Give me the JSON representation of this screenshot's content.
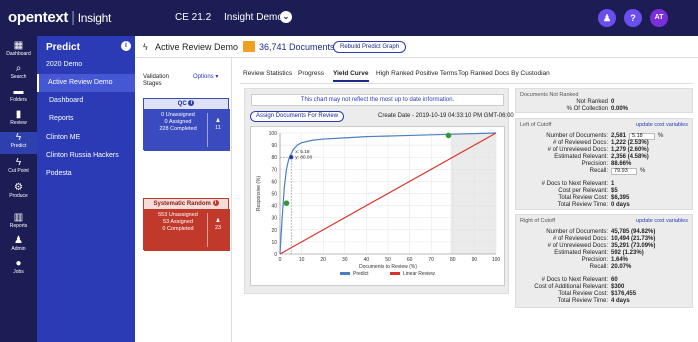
{
  "topbar": {
    "brand": "opentext",
    "product": "Insight",
    "version": "CE 21.2",
    "project": "Insight Demo",
    "help_label": "?",
    "user_initials": "AT"
  },
  "rail": {
    "items": [
      {
        "label": "Dashboard",
        "icon": "dashboard-icon"
      },
      {
        "label": "Search",
        "icon": "search-icon"
      },
      {
        "label": "Folders",
        "icon": "folder-icon"
      },
      {
        "label": "Review",
        "icon": "review-icon"
      },
      {
        "label": "Predict",
        "icon": "bolt-icon"
      },
      {
        "label": "Cut Point",
        "icon": "cut-icon"
      },
      {
        "label": "Produce",
        "icon": "gears-icon"
      },
      {
        "label": "Reports",
        "icon": "chart-icon"
      },
      {
        "label": "Admin",
        "icon": "admin-icon"
      },
      {
        "label": "Jobs",
        "icon": "jobs-icon"
      }
    ]
  },
  "predict_panel": {
    "title": "Predict",
    "items": [
      {
        "label": "2020 Demo"
      },
      {
        "label": "Active Review Demo"
      },
      {
        "label": "Dashboard"
      },
      {
        "label": "Reports"
      },
      {
        "label": "Clinton ME"
      },
      {
        "label": "Clinton Russia Hackers"
      },
      {
        "label": "Podesta"
      }
    ]
  },
  "header": {
    "view_title": "Active Review Demo",
    "doc_count": "36,741 Documents",
    "rebuild_label": "Rebuild Predict Graph"
  },
  "validation": {
    "label": "Validation Stages",
    "options_label": "Options ▾",
    "qc": {
      "title": "QC",
      "badge": "i",
      "lines": [
        "0 Unassigned",
        "0 Assigned",
        "228 Completed"
      ],
      "user_count": "11"
    },
    "sr": {
      "title": "Systematic Random",
      "badge": "i",
      "lines": [
        "553 Unassigned",
        "53 Assigned",
        "0 Completed"
      ],
      "user_count": "23"
    }
  },
  "tabs": [
    {
      "label": "Review Statistics"
    },
    {
      "label": "Progress"
    },
    {
      "label": "Yield Curve"
    },
    {
      "label": "High Ranked Positive Terms"
    },
    {
      "label": "Top Ranked Docs By Custodian"
    }
  ],
  "chart_panel": {
    "notice": "This chart may not reflect the most up to date information.",
    "assign_label": "Assign Documents For Review",
    "create_date": "Create Date - 2019-10-19 04:33:10 PM GMT-06:00"
  },
  "chart_data": {
    "type": "line",
    "xlabel": "Documents to Review (%)",
    "ylabel": "Responsive (%)",
    "xlim": [
      0,
      100
    ],
    "ylim": [
      0,
      100
    ],
    "x_ticks": [
      0,
      10,
      20,
      30,
      40,
      50,
      60,
      70,
      80,
      90,
      100
    ],
    "y_ticks": [
      0,
      10,
      20,
      30,
      40,
      50,
      60,
      70,
      80,
      90,
      100
    ],
    "grid": true,
    "legend_position": "bottom",
    "series": [
      {
        "name": "Predict",
        "color": "#4a7fc1",
        "x": [
          0,
          1,
          2,
          3,
          4,
          5,
          6,
          8,
          10,
          15,
          20,
          30,
          40,
          60,
          80,
          100
        ],
        "y": [
          0,
          30,
          55,
          70,
          78,
          82,
          86,
          90,
          92,
          94,
          95,
          96,
          97,
          98,
          99,
          100
        ]
      },
      {
        "name": "Linear Review",
        "color": "#d9342b",
        "x": [
          0,
          100
        ],
        "y": [
          0,
          100
        ]
      }
    ],
    "annotations": [
      {
        "type": "tooltip",
        "x": 5.18,
        "y": 80.0,
        "text_x": "x: 5.18",
        "text_y": "y: 80.00"
      }
    ],
    "markers": [
      {
        "x": 3,
        "y": 42,
        "color": "#2f9a35"
      },
      {
        "x": 78,
        "y": 98,
        "color": "#2f9a35"
      }
    ],
    "shaded_from_x": 79
  },
  "stats": {
    "not_ranked": {
      "header": "Documents Not Ranked",
      "rows": [
        {
          "k": "Not Ranked",
          "v": "0"
        },
        {
          "k": "% Of Collection",
          "v": "0.00%"
        }
      ]
    },
    "left": {
      "header": "Left of Cutoff",
      "link": "update cost variables",
      "rows": [
        {
          "k": "Number of Documents:",
          "v": "2,581",
          "input": "5.18",
          "unit": "%"
        },
        {
          "k": "# of Reviewed Docs:",
          "v": "1,222 (2.53%)"
        },
        {
          "k": "# of Unreviewed Docs:",
          "v": "1,279 (2.60%)"
        },
        {
          "k": "Estimated Relevant:",
          "v": "2,356 (4.58%)"
        },
        {
          "k": "Precision:",
          "v": "88.66%"
        },
        {
          "k": "Recall:",
          "v": "",
          "input": "79.93",
          "unit": "%"
        },
        {
          "k": "# Docs to Next Relevant:",
          "v": "1"
        },
        {
          "k": "Cost per Relevant:",
          "v": "$5"
        },
        {
          "k": "Total Review Cost:",
          "v": "$6,395"
        },
        {
          "k": "Total Review Time:",
          "v": "0 days"
        }
      ]
    },
    "right": {
      "header": "Right of Cutoff",
      "link": "update cost variables",
      "rows": [
        {
          "k": "Number of Documents:",
          "v": "45,785 (94.82%)"
        },
        {
          "k": "# of Reviewed Docs:",
          "v": "10,494 (21.73%)"
        },
        {
          "k": "# of Unreviewed Docs:",
          "v": "35,291 (73.09%)"
        },
        {
          "k": "Estimated Relevant:",
          "v": "592 (1.23%)"
        },
        {
          "k": "Precision:",
          "v": "1.64%"
        },
        {
          "k": "Recall:",
          "v": "20.07%"
        },
        {
          "k": "# Docs to Next Relevant:",
          "v": "60"
        },
        {
          "k": "Cost of Additional Relevant:",
          "v": "$300"
        },
        {
          "k": "Total Review Cost:",
          "v": "$176,455"
        },
        {
          "k": "Total Review Time:",
          "v": "4 days"
        }
      ]
    }
  }
}
